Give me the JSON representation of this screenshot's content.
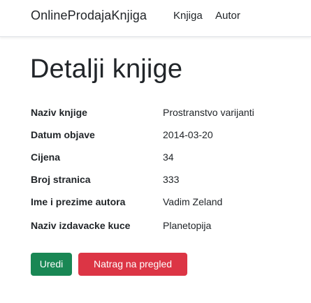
{
  "navbar": {
    "brand": "OnlineProdajaKnjiga",
    "links": [
      {
        "label": "Knjiga"
      },
      {
        "label": "Autor"
      }
    ]
  },
  "page": {
    "title": "Detalji knjige"
  },
  "details": [
    {
      "label": "Naziv knjige",
      "value": "Prostranstvo varijanti"
    },
    {
      "label": "Datum objave",
      "value": "2014-03-20"
    },
    {
      "label": "Cijena",
      "value": "34"
    },
    {
      "label": "Broj stranica",
      "value": "333"
    },
    {
      "label": "Ime i prezime autora",
      "value": "Vadim Zeland"
    },
    {
      "label": "Naziv izdavacke kuce",
      "value": "Planetopija"
    }
  ],
  "actions": {
    "edit_label": "Uredi",
    "back_label": "Natrag na pregled"
  },
  "colors": {
    "edit_button": "#198754",
    "back_button": "#dc3545",
    "text": "#212529"
  }
}
